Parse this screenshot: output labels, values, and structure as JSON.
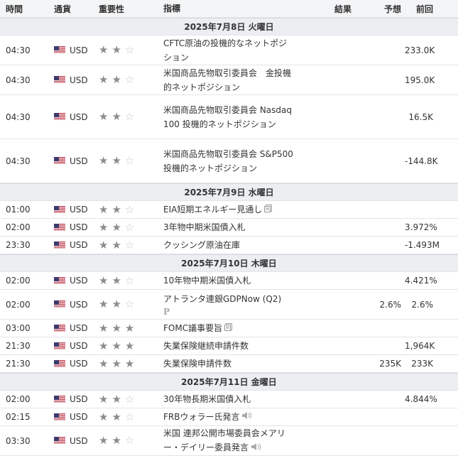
{
  "headers": {
    "time": "時間",
    "currency": "通貨",
    "importance": "重要性",
    "indicator": "指標",
    "actual": "結果",
    "forecast": "予想",
    "previous": "前回"
  },
  "colors": {
    "star_on": "#8c8c8c",
    "star_off": "#c8c8c8",
    "day_bg": "#eceef1",
    "header_bg": "#f4f5f7"
  },
  "days": [
    {
      "label": "2025年7月8日 火曜日",
      "events": [
        {
          "time": "04:30",
          "currency": "USD",
          "stars": 2,
          "indicator": "CFTC原油の投機的なネットポジション",
          "actual": "",
          "forecast": "",
          "previous": "233.0K",
          "lines": 2
        },
        {
          "time": "04:30",
          "currency": "USD",
          "stars": 2,
          "indicator": "米国商品先物取引委員会　金投機的ネットポジション",
          "actual": "",
          "forecast": "",
          "previous": "195.0K",
          "lines": 2
        },
        {
          "time": "04:30",
          "currency": "USD",
          "stars": 2,
          "indicator": "米国商品先物取引委員会 Nasdaq 100 投機的ネットポジション",
          "actual": "",
          "forecast": "",
          "previous": "16.5K",
          "lines": 3
        },
        {
          "time": "04:30",
          "currency": "USD",
          "stars": 2,
          "indicator": "米国商品先物取引委員会 S&P500　投機的ネットポジション",
          "actual": "",
          "forecast": "",
          "previous": "-144.8K",
          "lines": 3
        }
      ]
    },
    {
      "label": "2025年7月9日 水曜日",
      "events": [
        {
          "time": "01:00",
          "currency": "USD",
          "stars": 2,
          "indicator": "EIA短期エネルギー見通し",
          "icon": "document-icon",
          "actual": "",
          "forecast": "",
          "previous": "",
          "lines": 1
        },
        {
          "time": "02:00",
          "currency": "USD",
          "stars": 2,
          "indicator": "3年物中期米国債入札",
          "actual": "",
          "forecast": "",
          "previous": "3.972%",
          "lines": 1
        },
        {
          "time": "23:30",
          "currency": "USD",
          "stars": 2,
          "indicator": "クッシング原油在庫",
          "actual": "",
          "forecast": "",
          "previous": "-1.493M",
          "lines": 1
        }
      ]
    },
    {
      "label": "2025年7月10日 木曜日",
      "events": [
        {
          "time": "02:00",
          "currency": "USD",
          "stars": 2,
          "indicator": "10年物中期米国債入札",
          "actual": "",
          "forecast": "",
          "previous": "4.421%",
          "lines": 1
        },
        {
          "time": "02:00",
          "currency": "USD",
          "stars": 2,
          "indicator": "アトランタ連銀GDPNow (Q2)",
          "icon": "preliminary-icon",
          "actual": "",
          "forecast": "2.6%",
          "previous": "2.6%",
          "lines": 2
        },
        {
          "time": "03:00",
          "currency": "USD",
          "stars": 3,
          "indicator": "FOMC議事要旨",
          "icon": "document-icon",
          "actual": "",
          "forecast": "",
          "previous": "",
          "lines": 1
        },
        {
          "time": "21:30",
          "currency": "USD",
          "stars": 3,
          "indicator": "失業保険継続申請件数",
          "actual": "",
          "forecast": "",
          "previous": "1,964K",
          "lines": 1
        },
        {
          "time": "21:30",
          "currency": "USD",
          "stars": 3,
          "indicator": "失業保険申請件数",
          "actual": "",
          "forecast": "235K",
          "previous": "233K",
          "lines": 1
        }
      ]
    },
    {
      "label": "2025年7月11日 金曜日",
      "events": [
        {
          "time": "02:00",
          "currency": "USD",
          "stars": 2,
          "indicator": "30年物長期米国債入札",
          "actual": "",
          "forecast": "",
          "previous": "4.844%",
          "lines": 1
        },
        {
          "time": "02:15",
          "currency": "USD",
          "stars": 2,
          "indicator": "FRBウォラー氏発言",
          "icon": "speaker-icon",
          "actual": "",
          "forecast": "",
          "previous": "",
          "lines": 1
        },
        {
          "time": "03:30",
          "currency": "USD",
          "stars": 2,
          "indicator": "米国 連邦公開市場委員会メアリー・デイリー委員発言",
          "icon": "speaker-icon",
          "actual": "",
          "forecast": "",
          "previous": "",
          "lines": 2
        }
      ]
    }
  ]
}
